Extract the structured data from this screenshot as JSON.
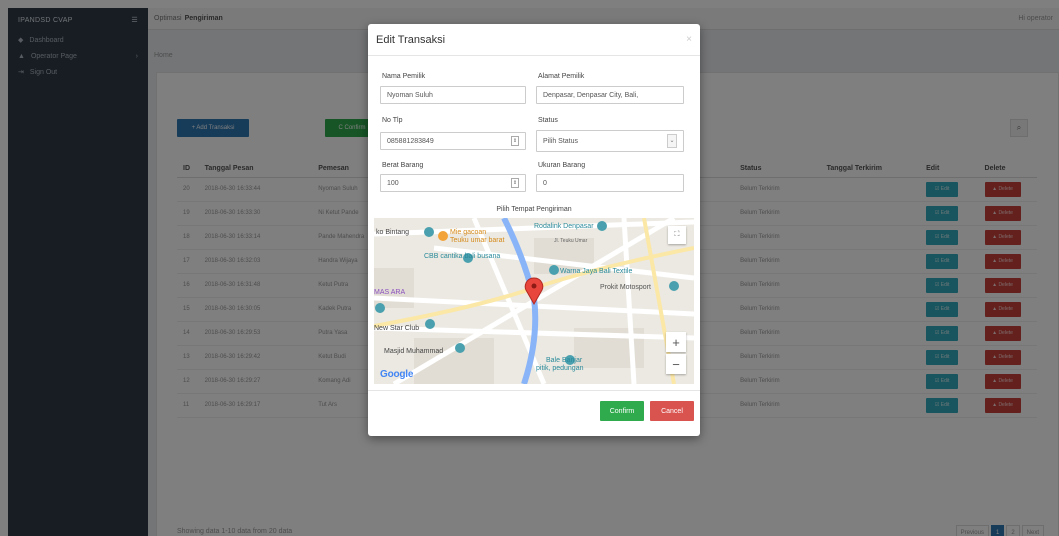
{
  "sidebar": {
    "brand": "IPANDSD CVAP",
    "menu_icon": "list-icon",
    "items": [
      {
        "label": "Dashboard",
        "icon": "dashboard-icon"
      },
      {
        "label": "Operator Page",
        "icon": "user-icon",
        "chevron": "›"
      },
      {
        "label": "Sign Out",
        "icon": "sign-out-icon"
      }
    ]
  },
  "topbar": {
    "prefix": "Optimasi",
    "title": "Pengiriman",
    "greeting": "Hi operator"
  },
  "breadcrumb": "Home",
  "toolbar": {
    "add_label": "+ Add Transaksi",
    "confirm_label": "C Confirm",
    "search_icon": "search-icon"
  },
  "table": {
    "headers": {
      "id": "ID",
      "tanggal": "Tanggal Pesan",
      "pemesan": "Pemesan",
      "status": "Status",
      "terkirim": "Tanggal Terkirim",
      "edit": "Edit",
      "delete": "Delete"
    },
    "rows": [
      {
        "id": "20",
        "tanggal": "2018-06-30 16:33:44",
        "pemesan": "Nyoman Suluh",
        "status": "Belum Terkirim"
      },
      {
        "id": "19",
        "tanggal": "2018-06-30 16:33:30",
        "pemesan": "Ni Ketut Pande",
        "status": "Belum Terkirim"
      },
      {
        "id": "18",
        "tanggal": "2018-06-30 16:33:14",
        "pemesan": "Pande Mahendra",
        "status": "Belum Terkirim"
      },
      {
        "id": "17",
        "tanggal": "2018-06-30 16:32:03",
        "pemesan": "Handra Wijaya",
        "status": "Belum Terkirim"
      },
      {
        "id": "16",
        "tanggal": "2018-06-30 16:31:48",
        "pemesan": "Ketut Putra",
        "status": "Belum Terkirim"
      },
      {
        "id": "15",
        "tanggal": "2018-06-30 16:30:05",
        "pemesan": "Kadek Putra",
        "status": "Belum Terkirim"
      },
      {
        "id": "14",
        "tanggal": "2018-06-30 16:29:53",
        "pemesan": "Putra Yasa",
        "status": "Belum Terkirim"
      },
      {
        "id": "13",
        "tanggal": "2018-06-30 16:29:42",
        "pemesan": "Ketut Budi",
        "status": "Belum Terkirim"
      },
      {
        "id": "12",
        "tanggal": "2018-06-30 16:29:27",
        "pemesan": "Komang Adi",
        "status": "Belum Terkirim"
      },
      {
        "id": "11",
        "tanggal": "2018-06-30 16:29:17",
        "pemesan": "Tut Ars",
        "status": "Belum Terkirim"
      }
    ],
    "edit_label": "☑ Edit",
    "delete_label": "▲ Delete"
  },
  "footer": {
    "showing": "Showing data 1-10 data from 20 data"
  },
  "pagination": {
    "previous": "Previous",
    "pages": [
      "1",
      "2"
    ],
    "next": "Next"
  },
  "modal": {
    "title": "Edit Transaksi",
    "close": "×",
    "nama_label": "Nama Pemilik",
    "nama_value": "Nyoman Suluh",
    "alamat_label": "Alamat Pemilik",
    "alamat_value": "Denpasar, Denpasar City, Bali,",
    "tlp_label": "No Tlp",
    "tlp_value": "085881283849",
    "status_label": "Status",
    "status_value": "Pilih Status",
    "berat_label": "Berat Barang",
    "berat_value": "100",
    "ukuran_label": "Ukuran Barang",
    "ukuran_value": "0",
    "map_title": "Pilih Tempat Pengiriman",
    "confirm_label": "Confirm",
    "cancel_label": "Cancel"
  },
  "map": {
    "labels": {
      "ko_bintang": "ko Bintang",
      "mie_gacoan": "Mie gacoan",
      "teuku_umar": "Teuku umar barat",
      "rodalink": "Rodalink Denpasar",
      "jl_teuku_umar": "Jl. Teuku Umar",
      "cbb": "CBB cantika bali busana",
      "warna_jaya": "Warna Jaya Bali Textile",
      "prokit": "Prokit Motosport",
      "mas_ara": "MAS ARA",
      "new_star": "New Star Club",
      "masjid": "Masjid Muhammad",
      "bale_banjar": "Bale Banjar",
      "pitik": "pitik, pedungan",
      "zoom_in": "+",
      "zoom_out": "−",
      "fullscreen": "⛶",
      "google": "Google"
    }
  },
  "colors": {
    "primary": "#2e78b4",
    "success": "#2fab4d",
    "danger": "#d9534f",
    "info": "#33aabc",
    "sidebar": "#2f3a47",
    "marker": "#e8453c"
  }
}
